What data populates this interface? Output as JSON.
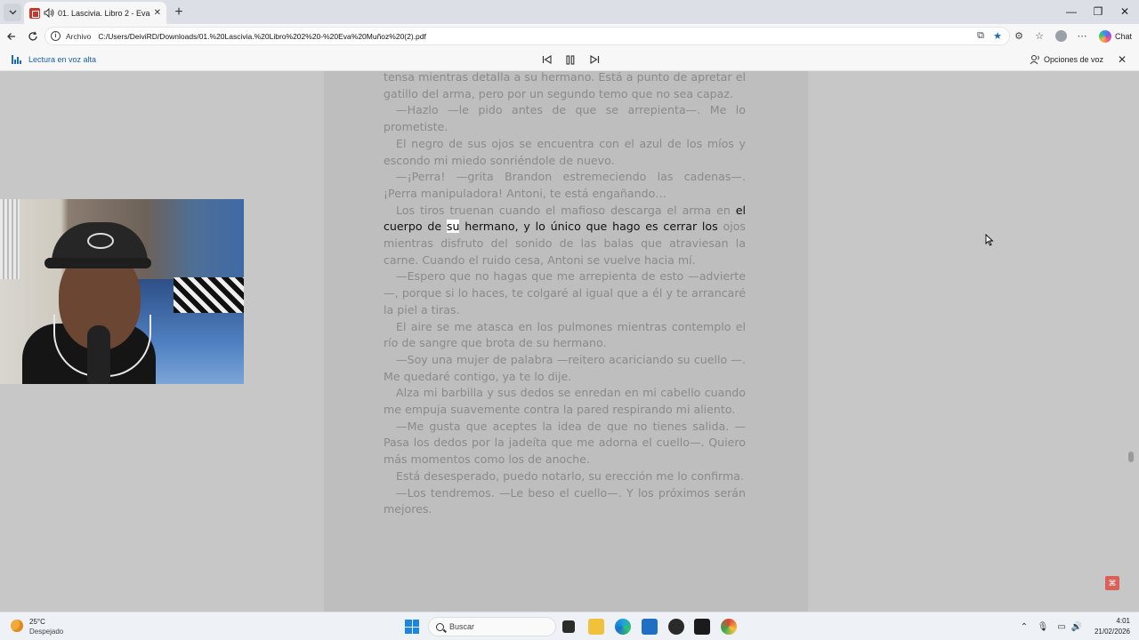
{
  "browser": {
    "tab": {
      "title": "01. Lascivia. Libro 2 - Eva Muñoz (2).pdf",
      "close_icon": "close-icon"
    },
    "new_tab_label": "+",
    "window_controls": {
      "minimize": "—",
      "restore": "❐",
      "close": "✕"
    },
    "address": {
      "scheme_label": "Archivo",
      "url": "C:/Users/DeiviRD/Downloads/01.%20Lascivia.%20Libro%202%20-%20Eva%20Muñoz%20(2).pdf"
    },
    "chat_label": "Chat"
  },
  "read_aloud": {
    "label": "Lectura en voz alta",
    "voice_options_label": "Opciones de voz"
  },
  "document": {
    "paragraphs": [
      {
        "text": "tensa mientras detalla a su hermano. Está a punto de apretar el gatillo del arma, pero por un segundo temo que no sea capaz.",
        "indent": false
      },
      {
        "text": "—Hazlo —le pido antes de que se arrepienta—. Me lo prometiste.",
        "indent": true
      },
      {
        "text": "El negro de sus ojos se encuentra con el azul de los míos y escondo mi miedo sonriéndole de nuevo.",
        "indent": true
      },
      {
        "text": "—¡Perra! —grita Brandon estremeciendo las cadenas—. ¡Perra manipuladora! Antoni, te está engañando…",
        "indent": true
      }
    ],
    "reading_paragraph": {
      "before": "Los tiros truenan cuando el mafioso descarga el arma en",
      "line_prefix": "el cuerpo de ",
      "current_word": "su",
      "line_suffix": " hermano, y lo único que hago es cerrar los",
      "after": "ojos mientras disfruto del sonido de las balas que atraviesan la carne. Cuando el ruido cesa, Antoni se vuelve hacia mí."
    },
    "paragraphs_after": [
      {
        "text": "—Espero que no hagas que me arrepienta de esto —advierte—, porque si lo haces, te colgaré al igual que a él y te arrancaré la piel a tiras.",
        "indent": true
      },
      {
        "text": "El aire se me atasca en los pulmones mientras contemplo el río de sangre que brota de su hermano.",
        "indent": true
      },
      {
        "text": "—Soy una mujer de palabra —reitero acariciando su cuello —. Me quedaré contigo, ya te lo dije.",
        "indent": true
      },
      {
        "text": "Alza mi barbilla y sus dedos se enredan en mi cabello cuando me empuja suavemente contra la pared respirando mi aliento.",
        "indent": true
      },
      {
        "text": "—Me gusta que aceptes la idea de que no tienes salida. —Pasa los dedos por la jadeíta que me adorna el cuello—. Quiero más momentos como los de anoche.",
        "indent": true
      },
      {
        "text": "Está desesperado, puedo notarlo, su erección me lo confirma.",
        "indent": true
      },
      {
        "text": "—Los tendremos. —Le beso el cuello—. Y los próximos serán mejores.",
        "indent": true
      }
    ]
  },
  "taskbar": {
    "weather_temp": "25°C",
    "weather_desc": "Despejado",
    "search_label": "Buscar",
    "time": "4:01",
    "date": "21/02/2026"
  },
  "colors": {
    "accent": "#1a6bbf",
    "page_bg": "#bebebe",
    "viewport_bg": "#c7c7c7",
    "text_dim": "#8a8a8a",
    "text_highlight": "#111111"
  }
}
